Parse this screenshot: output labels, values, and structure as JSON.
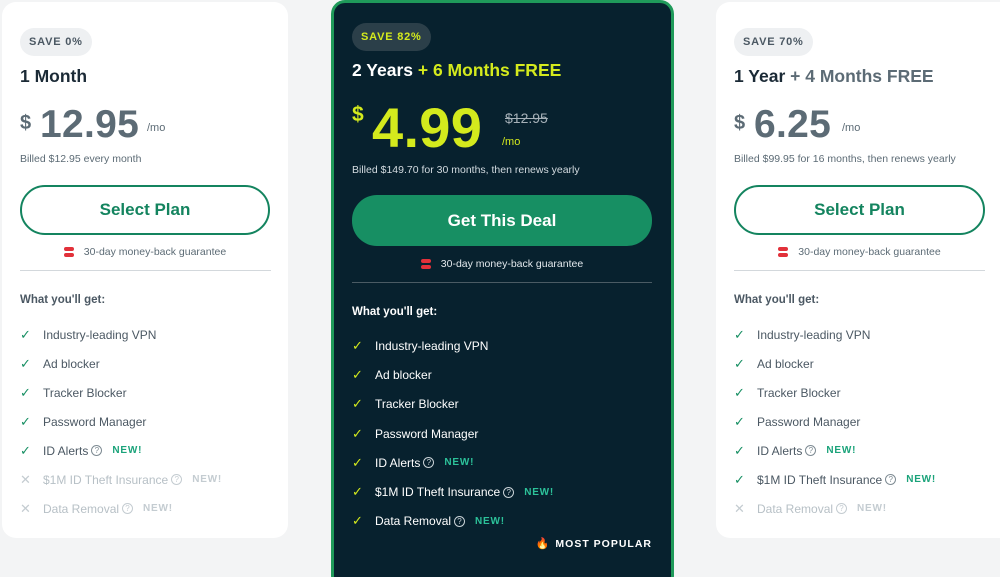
{
  "plans": [
    {
      "badge": "SAVE 0%",
      "title": "1 Month",
      "title_extra": "",
      "currency": "$",
      "price": "12.95",
      "old_price": "",
      "per": "/mo",
      "billed": "Billed $12.95 every month",
      "cta": "Select Plan",
      "guarantee": "30-day money-back guarantee",
      "features_heading": "What you'll get:",
      "features": [
        {
          "label": "Industry-leading VPN",
          "included": true,
          "help": false,
          "new_label": ""
        },
        {
          "label": "Ad blocker",
          "included": true,
          "help": false,
          "new_label": ""
        },
        {
          "label": "Tracker Blocker",
          "included": true,
          "help": false,
          "new_label": ""
        },
        {
          "label": "Password Manager",
          "included": true,
          "help": false,
          "new_label": ""
        },
        {
          "label": "ID Alerts",
          "included": true,
          "help": true,
          "new_label": "NEW!"
        },
        {
          "label": "$1M ID Theft Insurance",
          "included": false,
          "help": true,
          "new_label": "NEW!"
        },
        {
          "label": "Data Removal",
          "included": false,
          "help": true,
          "new_label": "NEW!"
        }
      ]
    },
    {
      "badge": "SAVE 82%",
      "title": "2 Years",
      "title_extra": "+ 6 Months FREE",
      "currency": "$",
      "price": "4.99",
      "old_price": "$12.95",
      "per": "/mo",
      "billed": "Billed $149.70 for 30 months, then renews yearly",
      "cta": "Get This Deal",
      "guarantee": "30-day money-back guarantee",
      "features_heading": "What you'll get:",
      "features": [
        {
          "label": "Industry-leading VPN",
          "included": true,
          "help": false,
          "new_label": ""
        },
        {
          "label": "Ad blocker",
          "included": true,
          "help": false,
          "new_label": ""
        },
        {
          "label": "Tracker Blocker",
          "included": true,
          "help": false,
          "new_label": ""
        },
        {
          "label": "Password Manager",
          "included": true,
          "help": false,
          "new_label": ""
        },
        {
          "label": "ID Alerts",
          "included": true,
          "help": true,
          "new_label": "NEW!"
        },
        {
          "label": "$1M ID Theft Insurance",
          "included": true,
          "help": true,
          "new_label": "NEW!"
        },
        {
          "label": "Data Removal",
          "included": true,
          "help": true,
          "new_label": "NEW!"
        }
      ],
      "popular_label": "MOST POPULAR"
    },
    {
      "badge": "SAVE 70%",
      "title": "1 Year",
      "title_extra": "+ 4 Months FREE",
      "currency": "$",
      "price": "6.25",
      "old_price": "",
      "per": "/mo",
      "billed": "Billed $99.95 for 16 months, then renews yearly",
      "cta": "Select Plan",
      "guarantee": "30-day money-back guarantee",
      "features_heading": "What you'll get:",
      "features": [
        {
          "label": "Industry-leading VPN",
          "included": true,
          "help": false,
          "new_label": ""
        },
        {
          "label": "Ad blocker",
          "included": true,
          "help": false,
          "new_label": ""
        },
        {
          "label": "Tracker Blocker",
          "included": true,
          "help": false,
          "new_label": ""
        },
        {
          "label": "Password Manager",
          "included": true,
          "help": false,
          "new_label": ""
        },
        {
          "label": "ID Alerts",
          "included": true,
          "help": true,
          "new_label": "NEW!"
        },
        {
          "label": "$1M ID Theft Insurance",
          "included": true,
          "help": true,
          "new_label": "NEW!"
        },
        {
          "label": "Data Removal",
          "included": false,
          "help": true,
          "new_label": "NEW!"
        }
      ]
    }
  ],
  "icons": {
    "check": "✓",
    "cross": "✕",
    "help": "?",
    "flame": "🔥"
  },
  "colors": {
    "accent_green": "#178f63",
    "featured_bg": "#07212e",
    "highlight_lime": "#d4ea1d",
    "guarantee_red": "#e2313a"
  }
}
